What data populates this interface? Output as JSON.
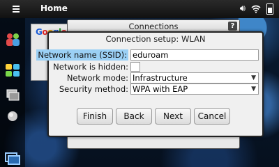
{
  "statusbar": {
    "title": "Home",
    "icons": [
      "menu-icon",
      "volume-icon",
      "wifi-icon",
      "battery-icon"
    ]
  },
  "launcher": {
    "icons": [
      "contacts-icon",
      "applications-icon",
      "task-switcher-icon",
      "web-icon",
      "switch-windows-icon"
    ]
  },
  "background_app": {
    "logo": "Google"
  },
  "connections_window": {
    "title": "Connections",
    "help_label": "?"
  },
  "dialog": {
    "title": "Connection setup: WLAN",
    "fields": {
      "ssid_label": "Network name (SSID):",
      "ssid_value": "eduroam",
      "hidden_label": "Network is hidden:",
      "hidden_checked": false,
      "mode_label": "Network mode:",
      "mode_value": "Infrastructure",
      "security_label": "Security method:",
      "security_value": "WPA with EAP"
    },
    "buttons": {
      "finish": "Finish",
      "back": "Back",
      "next": "Next",
      "cancel": "Cancel"
    }
  },
  "colors": {
    "ssid_highlight": "#9bd0f5",
    "statusbar_bg": "#1a1a1a",
    "dialog_bg": "#f0f0f0"
  }
}
